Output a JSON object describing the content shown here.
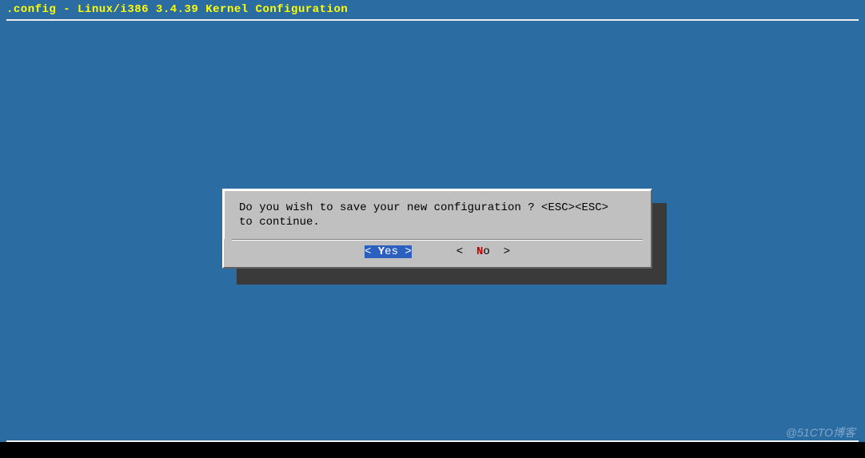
{
  "header": {
    "title": ".config - Linux/i386 3.4.39 Kernel Configuration"
  },
  "dialog": {
    "message_line1": "Do you wish to save your new configuration ? <ESC><ESC>",
    "message_line2": "to continue.",
    "buttons": {
      "yes": {
        "bracket_l": "<",
        "hotkey": "Y",
        "rest": "es",
        "bracket_r": ">"
      },
      "no": {
        "bracket_l": "<",
        "hotkey": "N",
        "rest": "o",
        "bracket_r": ">"
      }
    }
  },
  "watermark": "@51CTO博客"
}
